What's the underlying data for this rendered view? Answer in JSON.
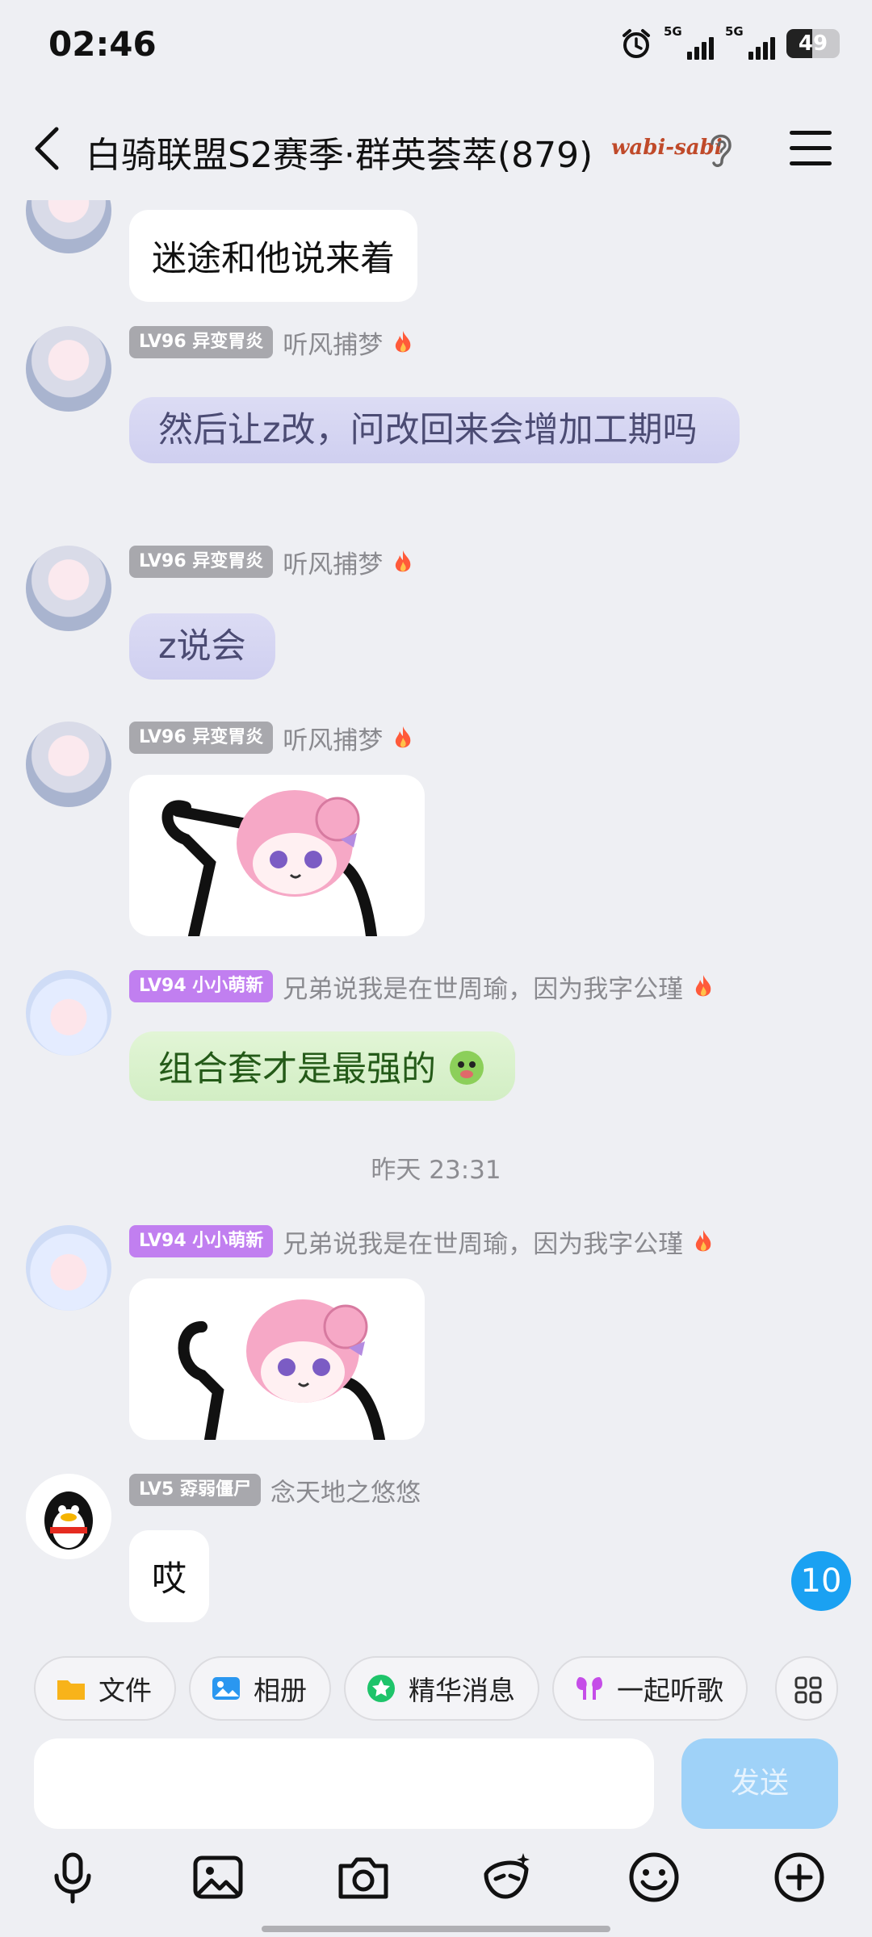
{
  "status_bar": {
    "time": "02:46",
    "network_1": "5G",
    "network_2": "5G",
    "battery": "49"
  },
  "header": {
    "title": "白骑联盟S2赛季·群英荟萃(879)",
    "badge_text": "wabi-sabi"
  },
  "messages": [
    {
      "text": "迷途和他说来着"
    },
    {
      "level": "LV96 异变胃炎",
      "nickname": "听风捕梦",
      "text": "然后让z改，问改回来会增加工期吗"
    },
    {
      "level": "LV96 异变胃炎",
      "nickname": "听风捕梦",
      "text": "z说会"
    },
    {
      "level": "LV96 异变胃炎",
      "nickname": "听风捕梦"
    },
    {
      "level": "LV94 小小萌新",
      "nickname": "兄弟说我是在世周瑜，因为我字公瑾",
      "text": "组合套才是最强的"
    },
    {
      "level": "LV94 小小萌新",
      "nickname": "兄弟说我是在世周瑜，因为我字公瑾"
    },
    {
      "level": "LV5 孬弱僵尸",
      "nickname": "念天地之悠悠",
      "text": "哎"
    }
  ],
  "timestamp": "昨天 23:31",
  "unread_count": "10",
  "quick_actions": [
    {
      "label": "文件",
      "icon": "folder-icon"
    },
    {
      "label": "相册",
      "icon": "album-icon"
    },
    {
      "label": "精华消息",
      "icon": "star-icon"
    },
    {
      "label": "一起听歌",
      "icon": "earbuds-icon"
    }
  ],
  "input": {
    "placeholder": "",
    "send_label": "发送"
  },
  "colors": {
    "accent": "#1aa1f2",
    "send_disabled": "#9fd2f8",
    "background": "#eeeff3"
  }
}
